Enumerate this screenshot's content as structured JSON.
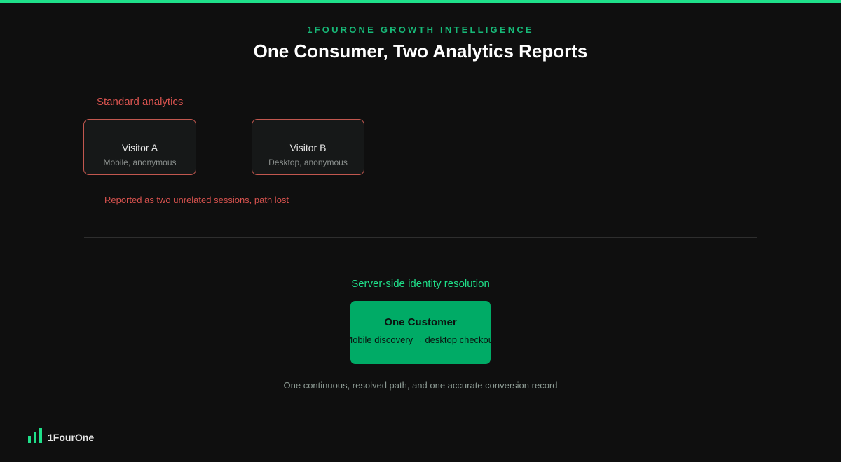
{
  "header": {
    "eyebrow": "1FOURONE GROWTH INTELLIGENCE",
    "title": "One Consumer, Two Analytics Reports"
  },
  "standard": {
    "label": "Standard analytics",
    "visitors": [
      {
        "name": "Visitor A",
        "detail": "Mobile, anonymous"
      },
      {
        "name": "Visitor B",
        "detail": "Desktop, anonymous"
      }
    ],
    "note": "Reported as two unrelated sessions, path lost"
  },
  "resolved": {
    "label": "Server-side identity resolution",
    "card_title": "One Customer",
    "path_from": "Mobile discovery",
    "path_arrow": "→",
    "path_to": "desktop checkout",
    "note": "One continuous, resolved path, and one accurate conversion record"
  },
  "brand": {
    "logo_text": "1FourOne",
    "accent": "#1fe08a",
    "warning": "#d9534f",
    "card_green": "#00ab66"
  }
}
